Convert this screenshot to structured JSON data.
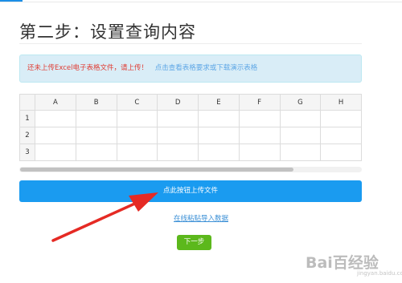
{
  "page": {
    "title": "第二步：设置查询内容"
  },
  "alert": {
    "warning": "还未上传Excel电子表格文件，请上传！",
    "help_link": "点击查看表格要求或下载演示表格"
  },
  "sheet": {
    "columns": [
      "A",
      "B",
      "C",
      "D",
      "E",
      "F",
      "G",
      "H"
    ],
    "rows": [
      "1",
      "2",
      "3"
    ]
  },
  "actions": {
    "upload_label": "点此按钮上传文件",
    "paste_label": "在线粘贴导入数据",
    "next_label": "下一步"
  },
  "watermark": {
    "brand": "Bai百经验",
    "sub": "jingyan.baidu.com"
  },
  "colors": {
    "primary": "#1a9bf0",
    "success": "#5cb81c",
    "warning_text": "#e03b32",
    "alert_bg": "#d9edf7",
    "annotation_arrow": "#e52a24"
  },
  "annotation": {
    "arrow_icon": "red-arrow-icon"
  }
}
